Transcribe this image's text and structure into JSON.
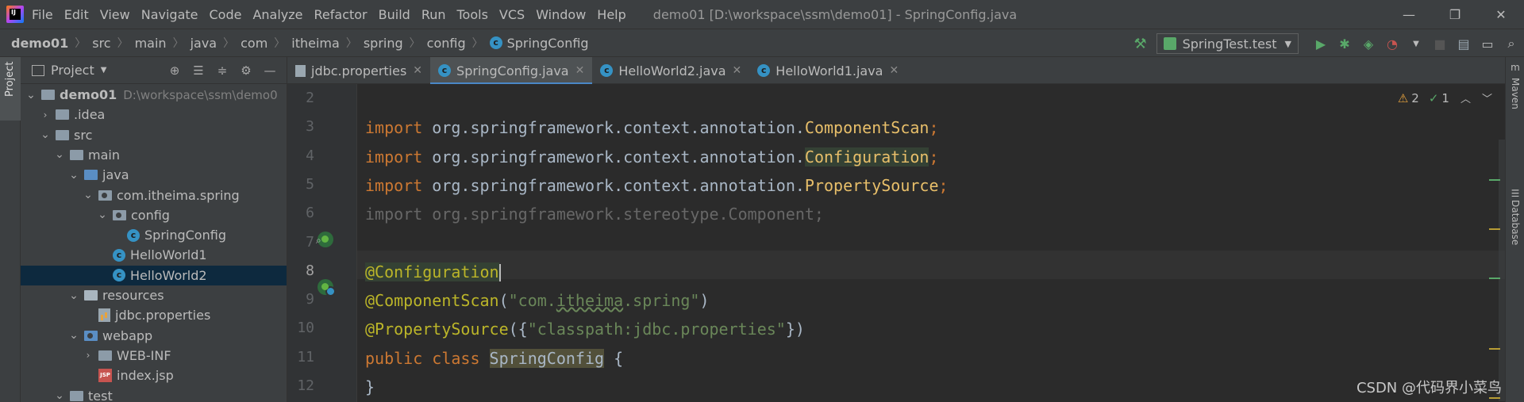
{
  "menubar": {
    "items": [
      "File",
      "Edit",
      "View",
      "Navigate",
      "Code",
      "Analyze",
      "Refactor",
      "Build",
      "Run",
      "Tools",
      "VCS",
      "Window",
      "Help"
    ],
    "title": "demo01 [D:\\workspace\\ssm\\demo01] - SpringConfig.java",
    "win_minimize": "—",
    "win_restore": "❐",
    "win_close": "✕"
  },
  "breadcrumb": [
    "demo01",
    "src",
    "main",
    "java",
    "com",
    "itheima",
    "spring",
    "config",
    "SpringConfig"
  ],
  "toolbar": {
    "run_config": "SpringTest.test",
    "accent_green": "#59a869"
  },
  "left_strip": {
    "project_tab": "Project"
  },
  "project": {
    "title": "Project",
    "tree": [
      {
        "label": "demo01",
        "path": "D:\\workspace\\ssm\\demo0",
        "depth": 0,
        "open": true,
        "kind": "module"
      },
      {
        "label": ".idea",
        "depth": 1,
        "open": false,
        "kind": "folder"
      },
      {
        "label": "src",
        "depth": 1,
        "open": true,
        "kind": "folder"
      },
      {
        "label": "main",
        "depth": 2,
        "open": true,
        "kind": "folder"
      },
      {
        "label": "java",
        "depth": 3,
        "open": true,
        "kind": "folder-blue"
      },
      {
        "label": "com.itheima.spring",
        "depth": 4,
        "open": true,
        "kind": "package"
      },
      {
        "label": "config",
        "depth": 5,
        "open": true,
        "kind": "package"
      },
      {
        "label": "SpringConfig",
        "depth": 6,
        "kind": "class"
      },
      {
        "label": "HelloWorld1",
        "depth": 5,
        "kind": "class"
      },
      {
        "label": "HelloWorld2",
        "depth": 5,
        "kind": "class",
        "selected": true
      },
      {
        "label": "resources",
        "depth": 3,
        "open": true,
        "kind": "folder-res"
      },
      {
        "label": "jdbc.properties",
        "depth": 4,
        "kind": "props"
      },
      {
        "label": "webapp",
        "depth": 3,
        "open": true,
        "kind": "folder-web"
      },
      {
        "label": "WEB-INF",
        "depth": 4,
        "open": false,
        "kind": "folder"
      },
      {
        "label": "index.jsp",
        "depth": 4,
        "kind": "jsp"
      },
      {
        "label": "test",
        "depth": 2,
        "open": true,
        "kind": "folder"
      }
    ]
  },
  "tabs": [
    {
      "label": "jdbc.properties",
      "kind": "props",
      "active": false
    },
    {
      "label": "SpringConfig.java",
      "kind": "class",
      "active": true
    },
    {
      "label": "HelloWorld2.java",
      "kind": "class",
      "active": false
    },
    {
      "label": "HelloWorld1.java",
      "kind": "class",
      "active": false
    }
  ],
  "right_strip": {
    "maven": "Maven",
    "database": "Database"
  },
  "inspections": {
    "warnings": "2",
    "passed": "1"
  },
  "editor": {
    "line_numbers": [
      "2",
      "3",
      "4",
      "5",
      "6",
      "7",
      "8",
      "9",
      "10",
      "11",
      "12"
    ],
    "current_line": "8",
    "lines": [
      {
        "n": "2",
        "tokens": []
      },
      {
        "n": "3",
        "tokens": [
          {
            "t": "import ",
            "c": "kw"
          },
          {
            "t": "org.springframework.context.annotation.",
            "c": "cls"
          },
          {
            "t": "ComponentScan",
            "c": "imp-cls"
          },
          {
            "t": ";",
            "c": "kw"
          }
        ]
      },
      {
        "n": "4",
        "tokens": [
          {
            "t": "import ",
            "c": "kw"
          },
          {
            "t": "org.springframework.context.annotation.",
            "c": "cls"
          },
          {
            "t": "Configuration",
            "c": "imp-cls hl-cls"
          },
          {
            "t": ";",
            "c": "kw"
          }
        ]
      },
      {
        "n": "5",
        "tokens": [
          {
            "t": "import ",
            "c": "kw"
          },
          {
            "t": "org.springframework.context.annotation.",
            "c": "cls"
          },
          {
            "t": "PropertySource",
            "c": "imp-cls"
          },
          {
            "t": ";",
            "c": "kw"
          }
        ]
      },
      {
        "n": "6",
        "tokens": [
          {
            "t": "import org.springframework.stereotype.Component;",
            "c": "unused"
          }
        ]
      },
      {
        "n": "7",
        "tokens": []
      },
      {
        "n": "8",
        "tokens": [
          {
            "t": "@Configuration",
            "c": "ann hl-cls"
          }
        ]
      },
      {
        "n": "9",
        "tokens": [
          {
            "t": "@ComponentScan",
            "c": "ann"
          },
          {
            "t": "(",
            "c": "cls"
          },
          {
            "t": "\"com.",
            "c": "str"
          },
          {
            "t": "itheima",
            "c": "str squiggle"
          },
          {
            "t": ".spring\"",
            "c": "str"
          },
          {
            "t": ")",
            "c": "cls"
          }
        ]
      },
      {
        "n": "10",
        "tokens": [
          {
            "t": "@PropertySource",
            "c": "ann"
          },
          {
            "t": "({",
            "c": "cls"
          },
          {
            "t": "\"classpath:jdbc.properties\"",
            "c": "str"
          },
          {
            "t": "})",
            "c": "cls"
          }
        ]
      },
      {
        "n": "11",
        "tokens": [
          {
            "t": "public class ",
            "c": "kw"
          },
          {
            "t": "SpringConfig",
            "c": "cls hl-decl"
          },
          {
            "t": " {",
            "c": "cls"
          }
        ]
      },
      {
        "n": "12",
        "tokens": [
          {
            "t": "}",
            "c": "cls"
          }
        ]
      }
    ]
  },
  "watermark": "CSDN @代码界小菜鸟"
}
